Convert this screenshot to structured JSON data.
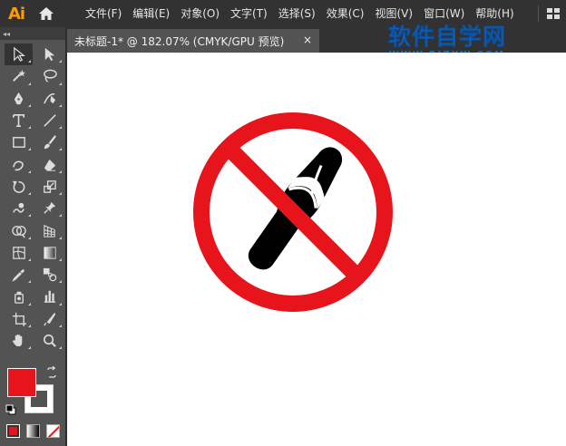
{
  "app": {
    "logo_text": "Ai",
    "menu": [
      "文件(F)",
      "编辑(E)",
      "对象(O)",
      "文字(T)",
      "选择(S)",
      "效果(C)",
      "视图(V)",
      "窗口(W)",
      "帮助(H)"
    ]
  },
  "toolbar": {
    "collapse_label": "◂◂",
    "tools": [
      {
        "name": "selection-tool",
        "icon": "selection-arrow-icon",
        "active": true
      },
      {
        "name": "direct-selection-tool",
        "icon": "direct-selection-arrow-icon"
      },
      {
        "name": "magic-wand-tool",
        "icon": "magic-wand-icon"
      },
      {
        "name": "lasso-tool",
        "icon": "lasso-icon"
      },
      {
        "name": "pen-tool",
        "icon": "pen-icon"
      },
      {
        "name": "curvature-tool",
        "icon": "curvature-icon"
      },
      {
        "name": "type-tool",
        "icon": "type-icon"
      },
      {
        "name": "line-segment-tool",
        "icon": "line-segment-icon"
      },
      {
        "name": "rectangle-tool",
        "icon": "rectangle-icon"
      },
      {
        "name": "paintbrush-tool",
        "icon": "paintbrush-icon"
      },
      {
        "name": "shaper-tool",
        "icon": "shaper-icon"
      },
      {
        "name": "eraser-tool",
        "icon": "eraser-icon"
      },
      {
        "name": "rotate-tool",
        "icon": "rotate-icon"
      },
      {
        "name": "scale-tool",
        "icon": "scale-icon"
      },
      {
        "name": "warp-tool",
        "icon": "warp-icon"
      },
      {
        "name": "puppet-warp-tool",
        "icon": "pushpin-icon"
      },
      {
        "name": "shape-builder-tool",
        "icon": "shape-builder-icon"
      },
      {
        "name": "perspective-grid-tool",
        "icon": "perspective-grid-icon"
      },
      {
        "name": "mesh-tool",
        "icon": "mesh-icon"
      },
      {
        "name": "gradient-tool",
        "icon": "gradient-icon"
      },
      {
        "name": "eyedropper-tool",
        "icon": "eyedropper-icon"
      },
      {
        "name": "blend-tool",
        "icon": "blend-icon"
      },
      {
        "name": "symbol-sprayer-tool",
        "icon": "symbol-sprayer-icon"
      },
      {
        "name": "column-graph-tool",
        "icon": "column-graph-icon"
      },
      {
        "name": "artboard-tool",
        "icon": "artboard-icon"
      },
      {
        "name": "slice-tool",
        "icon": "slice-icon"
      },
      {
        "name": "hand-tool",
        "icon": "hand-icon"
      },
      {
        "name": "zoom-tool",
        "icon": "zoom-icon"
      }
    ],
    "fill_color": "#e8141c",
    "stroke_color": "none"
  },
  "document": {
    "tab_title": "未标题-1* @ 182.07% (CMYK/GPU 预览)",
    "close_label": "×"
  },
  "watermark": {
    "main": "软件自学网",
    "url": "WWW.RJZXW.COM"
  },
  "artwork": {
    "sign_color": "#e8141c",
    "slipper_color": "#000000"
  }
}
